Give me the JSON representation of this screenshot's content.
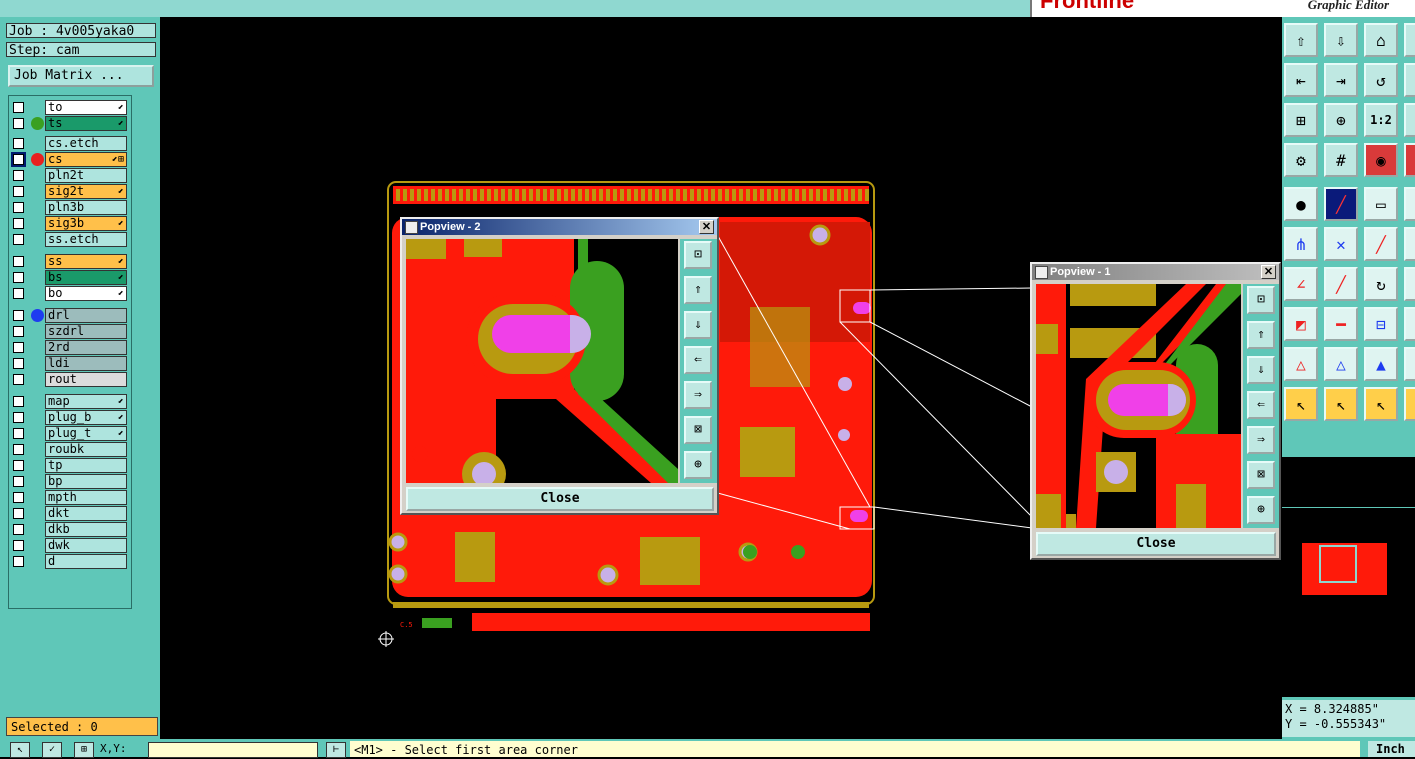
{
  "app": {
    "brand_logo": "Frontline",
    "brand_title": "Graphic Editor"
  },
  "left": {
    "job": "Job : 4v005yaka0",
    "step": "Step: cam",
    "job_matrix": "Job Matrix ...",
    "selected": "Selected : 0",
    "layers": [
      {
        "name": "to",
        "bg": "#ffffff",
        "dot": "",
        "mark": "⬋"
      },
      {
        "name": "ts",
        "bg": "#1a9a6a",
        "dot": "#3aa020",
        "mark": "⬋"
      },
      {
        "name": "cs.etch",
        "bg": "#aee4de",
        "dot": "",
        "mark": ""
      },
      {
        "name": "cs",
        "bg": "#ffc04a",
        "dot": "#e82020",
        "mark": "⬋⊞",
        "work": true
      },
      {
        "name": "pln2t",
        "bg": "#aee4de",
        "dot": "",
        "mark": ""
      },
      {
        "name": "sig2t",
        "bg": "#ffc04a",
        "dot": "",
        "mark": "⬋"
      },
      {
        "name": "pln3b",
        "bg": "#aee4de",
        "dot": "",
        "mark": ""
      },
      {
        "name": "sig3b",
        "bg": "#ffc04a",
        "dot": "",
        "mark": "⬋"
      },
      {
        "name": "ss.etch",
        "bg": "#aee4de",
        "dot": "",
        "mark": ""
      },
      {
        "name": "ss",
        "bg": "#ffc04a",
        "dot": "",
        "mark": "⬋"
      },
      {
        "name": "bs",
        "bg": "#1a9a6a",
        "dot": "",
        "mark": "⬋"
      },
      {
        "name": "bo",
        "bg": "#ffffff",
        "dot": "",
        "mark": "⬋"
      },
      {
        "name": "drl",
        "bg": "#9cbcbc",
        "dot": "#1e3cf0",
        "mark": ""
      },
      {
        "name": "szdrl",
        "bg": "#9cbcbc",
        "dot": "",
        "mark": ""
      },
      {
        "name": "2rd",
        "bg": "#9cbcbc",
        "dot": "",
        "mark": ""
      },
      {
        "name": "ldi",
        "bg": "#9cbcbc",
        "dot": "",
        "mark": ""
      },
      {
        "name": "rout",
        "bg": "#dcdcdc",
        "dot": "",
        "mark": ""
      },
      {
        "name": "map",
        "bg": "#aee4de",
        "dot": "",
        "mark": "⬋"
      },
      {
        "name": "plug_b",
        "bg": "#aee4de",
        "dot": "",
        "mark": "⬋"
      },
      {
        "name": "plug_t",
        "bg": "#aee4de",
        "dot": "",
        "mark": "⬋"
      },
      {
        "name": "roubk",
        "bg": "#aee4de",
        "dot": "",
        "mark": ""
      },
      {
        "name": "tp",
        "bg": "#aee4de",
        "dot": "",
        "mark": ""
      },
      {
        "name": "bp",
        "bg": "#aee4de",
        "dot": "",
        "mark": ""
      },
      {
        "name": "mpth",
        "bg": "#aee4de",
        "dot": "",
        "mark": ""
      },
      {
        "name": "dkt",
        "bg": "#aee4de",
        "dot": "",
        "mark": ""
      },
      {
        "name": "dkb",
        "bg": "#aee4de",
        "dot": "",
        "mark": ""
      },
      {
        "name": "dwk",
        "bg": "#aee4de",
        "dot": "",
        "mark": ""
      },
      {
        "name": "d",
        "bg": "#aee4de",
        "dot": "",
        "mark": ""
      }
    ]
  },
  "popups": {
    "p2": {
      "title": "Popview - 2",
      "close": "Close"
    },
    "p1": {
      "title": "Popview - 1",
      "close": "Close"
    }
  },
  "status": {
    "coord_label": "X,Y:",
    "message": "<M1> - Select first area corner",
    "unit": "Inch"
  },
  "right": {
    "x": "X = 8.324885\"",
    "y": "Y = -0.555343\""
  },
  "colors": {
    "copper": "#ff1a0a",
    "mask": "#b89a10",
    "green": "#3aa020",
    "magenta": "#f040e8"
  }
}
